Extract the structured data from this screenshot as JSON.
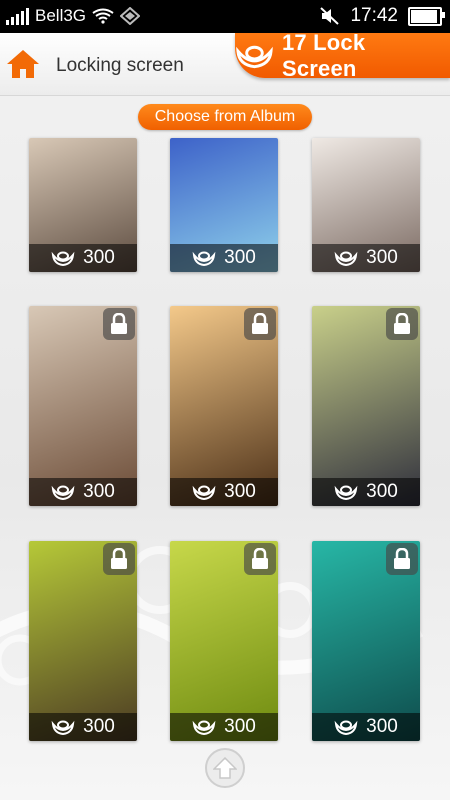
{
  "status_bar": {
    "carrier": "Bell3G",
    "time": "17:42",
    "battery_level": 0.85
  },
  "header": {
    "page_title": "Locking screen",
    "brand_title": "17 Lock Screen",
    "home_icon": "home-icon",
    "brand_icon": "gold-ingot-icon"
  },
  "album_button": {
    "label": "Choose from Album"
  },
  "accent_color": "#f26a06",
  "wallpapers": [
    {
      "price": "300",
      "locked": false,
      "colors": [
        "#d8c8b6",
        "#5d4c40"
      ]
    },
    {
      "price": "300",
      "locked": false,
      "colors": [
        "#3d62c9",
        "#8fd1ea"
      ]
    },
    {
      "price": "300",
      "locked": false,
      "colors": [
        "#efe9e4",
        "#7b6a62"
      ]
    },
    {
      "price": "300",
      "locked": true,
      "colors": [
        "#d8c8b6",
        "#6a4a35"
      ]
    },
    {
      "price": "300",
      "locked": true,
      "colors": [
        "#f4c98a",
        "#4a2e16"
      ]
    },
    {
      "price": "300",
      "locked": true,
      "colors": [
        "#c9d08a",
        "#2e2e3c"
      ]
    },
    {
      "price": "300",
      "locked": true,
      "colors": [
        "#b6c938",
        "#4b3a23"
      ]
    },
    {
      "price": "300",
      "locked": true,
      "colors": [
        "#c7d84a",
        "#6e8a10"
      ]
    },
    {
      "price": "300",
      "locked": true,
      "colors": [
        "#27b7a6",
        "#0e4b4b"
      ]
    }
  ]
}
